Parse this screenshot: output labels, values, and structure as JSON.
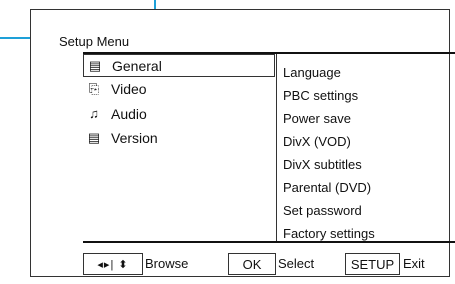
{
  "menu": {
    "title": "Setup Menu"
  },
  "categories": [
    {
      "icon": "settings-icon",
      "glyph": "▤",
      "label": "General",
      "selected": true
    },
    {
      "icon": "video-camera-icon",
      "glyph": "⎘",
      "label": "Video",
      "selected": false
    },
    {
      "icon": "music-note-icon",
      "glyph": "♫",
      "label": "Audio",
      "selected": false
    },
    {
      "icon": "info-icon",
      "glyph": "▤",
      "label": "Version",
      "selected": false
    }
  ],
  "options": [
    "Language",
    "PBC settings",
    "Power save",
    "DivX (VOD)",
    "DivX subtitles",
    "Parental (DVD)",
    "Set password",
    "Factory settings"
  ],
  "footer": {
    "nav_glyphs": "◂▸| ⬍",
    "browse": "Browse",
    "ok_button": "OK",
    "select": "Select",
    "setup_button": "SETUP",
    "exit": "Exit"
  }
}
